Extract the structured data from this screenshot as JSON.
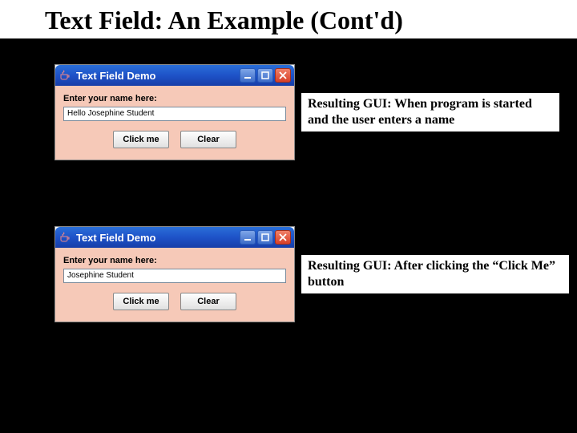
{
  "slide": {
    "title": "Text Field: An Example (Cont'd)"
  },
  "demo1": {
    "window_title": "Text Field Demo",
    "label": "Enter your name here:",
    "input_value": "Hello Josephine Student",
    "button_click": "Click me",
    "button_clear": "Clear"
  },
  "demo2": {
    "window_title": "Text Field Demo",
    "label": "Enter your name here:",
    "input_value": "Josephine Student",
    "button_click": "Click me",
    "button_clear": "Clear"
  },
  "captions": {
    "cap1": "Resulting GUI: When program is started and the user enters a name",
    "cap2": "Resulting GUI: After clicking the “Click Me” button"
  },
  "icons": {
    "minimize": "minimize-icon",
    "maximize": "maximize-icon",
    "close": "close-icon",
    "java": "java-coffee-icon"
  }
}
